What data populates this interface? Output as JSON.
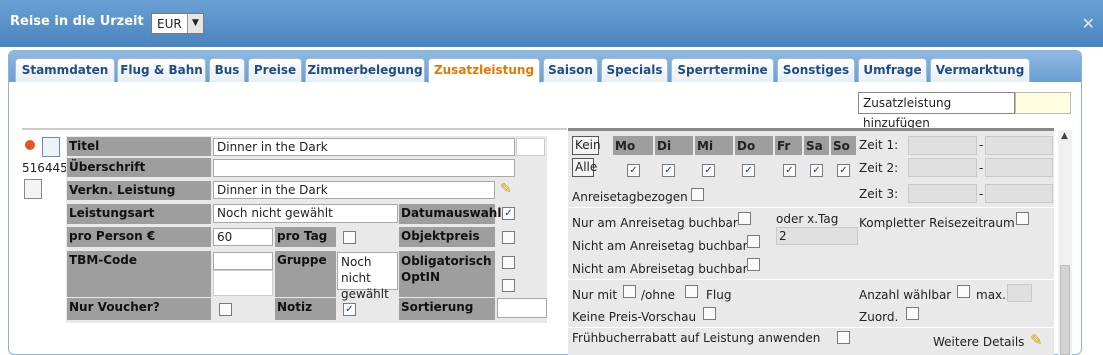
{
  "window": {
    "title": "Reise in die Urzeit",
    "currency": "EUR"
  },
  "tabs": [
    {
      "label": "Stammdaten"
    },
    {
      "label": "Flug & Bahn"
    },
    {
      "label": "Bus"
    },
    {
      "label": "Preise"
    },
    {
      "label": "Zimmerbelegung"
    },
    {
      "label": "Zusatzleistung"
    },
    {
      "label": "Saison"
    },
    {
      "label": "Specials"
    },
    {
      "label": "Sperrtermine"
    },
    {
      "label": "Sonstiges"
    },
    {
      "label": "Umfrage"
    },
    {
      "label": "Vermarktung"
    }
  ],
  "add_button": "Zusatzleistung hinzufügen",
  "item": {
    "id": "516445",
    "titel_label": "Titel",
    "titel_value": "Dinner in the Dark",
    "ueberschrift_label": "Überschrift",
    "ueberschrift_value": "",
    "verkn_label": "Verkn. Leistung",
    "verkn_value": "Dinner in the Dark",
    "leistungsart_label": "Leistungsart",
    "leistungsart_value": "Noch nicht gewählt",
    "datumsauswahl_label": "Datumauswahl",
    "pro_person_label": "pro Person €",
    "pro_person_value": "60",
    "pro_tag_label": "pro Tag",
    "objektpreis_label": "Objektpreis",
    "tbm_label": "TBM-Code",
    "tbm_value": "",
    "gruppe_label": "Gruppe",
    "gruppe_value": "Noch nicht gewählt",
    "obligatorisch_label": "Obligatorisch OptIN",
    "nur_voucher_label": "Nur Voucher?",
    "notiz_label": "Notiz",
    "sortierung_label": "Sortierung",
    "sortierung_value": ""
  },
  "days": {
    "kein": "Kein",
    "alle": "Alle",
    "headers": [
      "Mo",
      "Di",
      "Mi",
      "Do",
      "Fr",
      "Sa",
      "So"
    ],
    "checked": [
      true,
      true,
      true,
      true,
      true,
      true,
      true
    ]
  },
  "times": {
    "zeit1": "Zeit 1:",
    "zeit2": "Zeit 2:",
    "zeit3": "Zeit 3:",
    "sep": "-"
  },
  "options": {
    "anreisetagbezogen": "Anreisetagbezogen",
    "nur_anreisetag": "Nur am Anreisetag buchbar",
    "oder_x_tag": "oder x.Tag",
    "oder_x_tag_value": "2",
    "kompletter": "Kompletter Reisezeitraum",
    "nicht_anreisetag": "Nicht am Anreisetag buchbar",
    "nicht_abreisetag": "Nicht am Abreisetag buchbar",
    "nur_mit": "Nur mit",
    "ohne": "/ohne",
    "flug": "Flug",
    "anzahl": "Anzahl wählbar",
    "max": "max.",
    "keine_preis": "Keine Preis-Vorschau",
    "zuord": "Zuord.",
    "fruehbucher": "Frühbucherrabatt auf Leistung anwenden",
    "weitere": "Weitere Details"
  }
}
